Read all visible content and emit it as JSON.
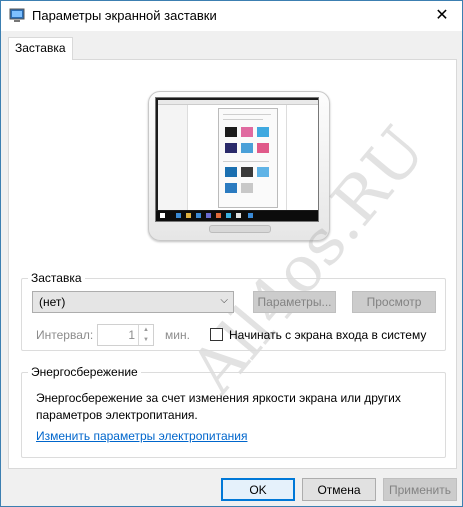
{
  "window": {
    "title": "Параметры экранной заставки",
    "close_glyph": "✕",
    "icon": "screensaver-app-icon"
  },
  "tabs": [
    {
      "label": "Заставка",
      "selected": true
    }
  ],
  "preview": {
    "watermark": "All4os.RU"
  },
  "screensaver_group": {
    "legend": "Заставка",
    "combo_value": "(нет)",
    "params_button": "Параметры...",
    "preview_button": "Просмотр",
    "interval_label": "Интервал:",
    "interval_value": "1",
    "interval_unit": "мин.",
    "logon_checkbox_label": "Начинать с экрана входа в систему",
    "logon_checked": false
  },
  "power_group": {
    "legend": "Энергосбережение",
    "text": "Энергосбережение за счет изменения яркости экрана или других параметров электропитания.",
    "link": "Изменить параметры электропитания"
  },
  "buttons": {
    "ok": "OK",
    "cancel": "Отмена",
    "apply": "Применить"
  },
  "colors": {
    "link": "#0066cc",
    "ok_border": "#0078d7",
    "disabled_text": "#838383"
  }
}
